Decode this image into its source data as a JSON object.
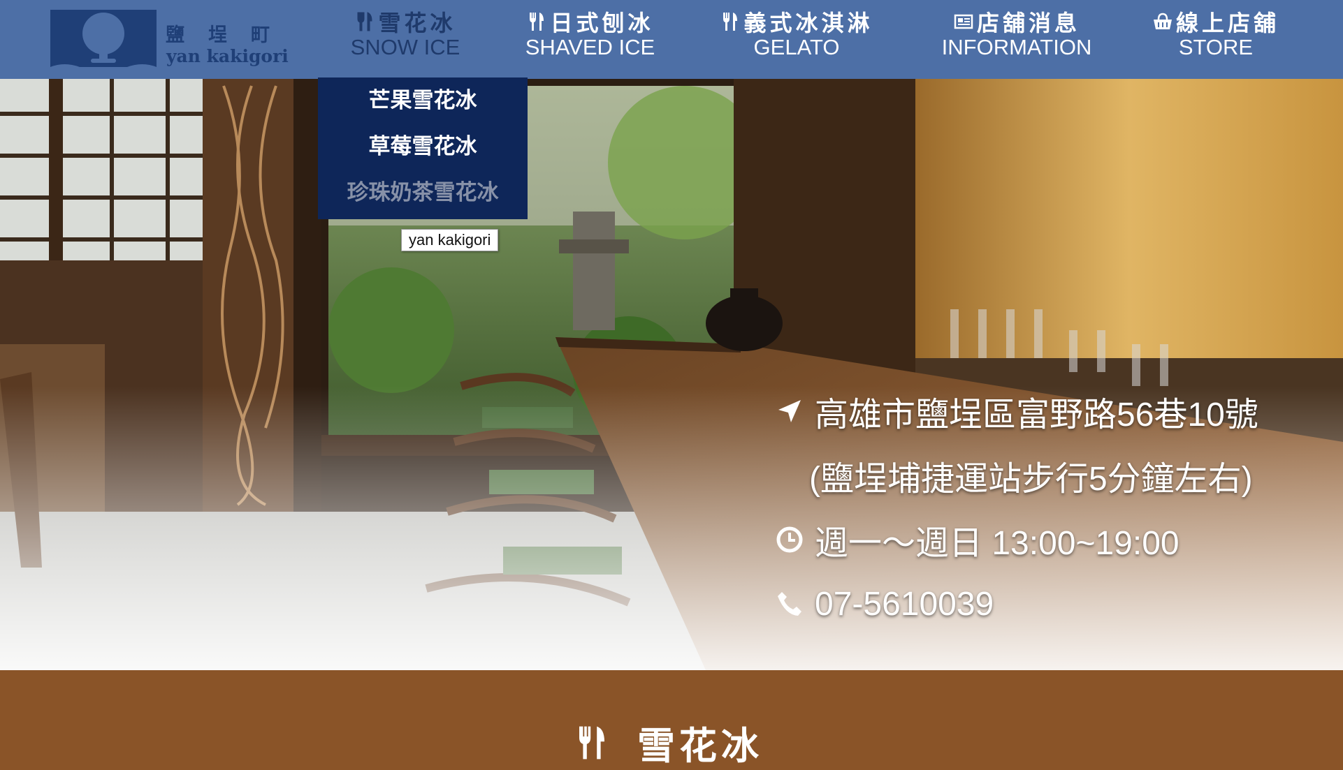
{
  "brand": {
    "name_zh": "鹽埕町",
    "name_en": "yan kakigori"
  },
  "nav": [
    {
      "zh": "雪花冰",
      "en": "SNOW ICE",
      "icon": "utensils-icon",
      "active": true
    },
    {
      "zh": "日式刨冰",
      "en": "SHAVED ICE",
      "icon": "utensils-icon"
    },
    {
      "zh": "義式冰淇淋",
      "en": "GELATO",
      "icon": "utensils-icon"
    },
    {
      "zh": "店舖消息",
      "en": "INFORMATION",
      "icon": "newspaper-icon"
    },
    {
      "zh": "線上店舖",
      "en": "STORE",
      "icon": "basket-icon"
    }
  ],
  "dropdown": [
    {
      "label": "芒果雪花冰"
    },
    {
      "label": "草莓雪花冰"
    },
    {
      "label": "珍珠奶茶雪花冰",
      "hovered": true
    }
  ],
  "tooltip": "yan kakigori",
  "store_info": {
    "address": "高雄市鹽埕區富野路56巷10號",
    "directions": "(鹽埕埔捷運站步行5分鐘左右)",
    "hours": "週一～週日 13:00~19:00",
    "phone": "07-5610039",
    "icons": [
      "location-arrow-icon",
      "clock-icon",
      "phone-icon"
    ]
  },
  "section": {
    "title": "雪花冰",
    "icon": "utensils-icon",
    "background": "#8a5428"
  },
  "colors": {
    "navbar": "#4d6fa6",
    "dropdown": "#0e2659",
    "active_nav": "#1f3a6b"
  }
}
